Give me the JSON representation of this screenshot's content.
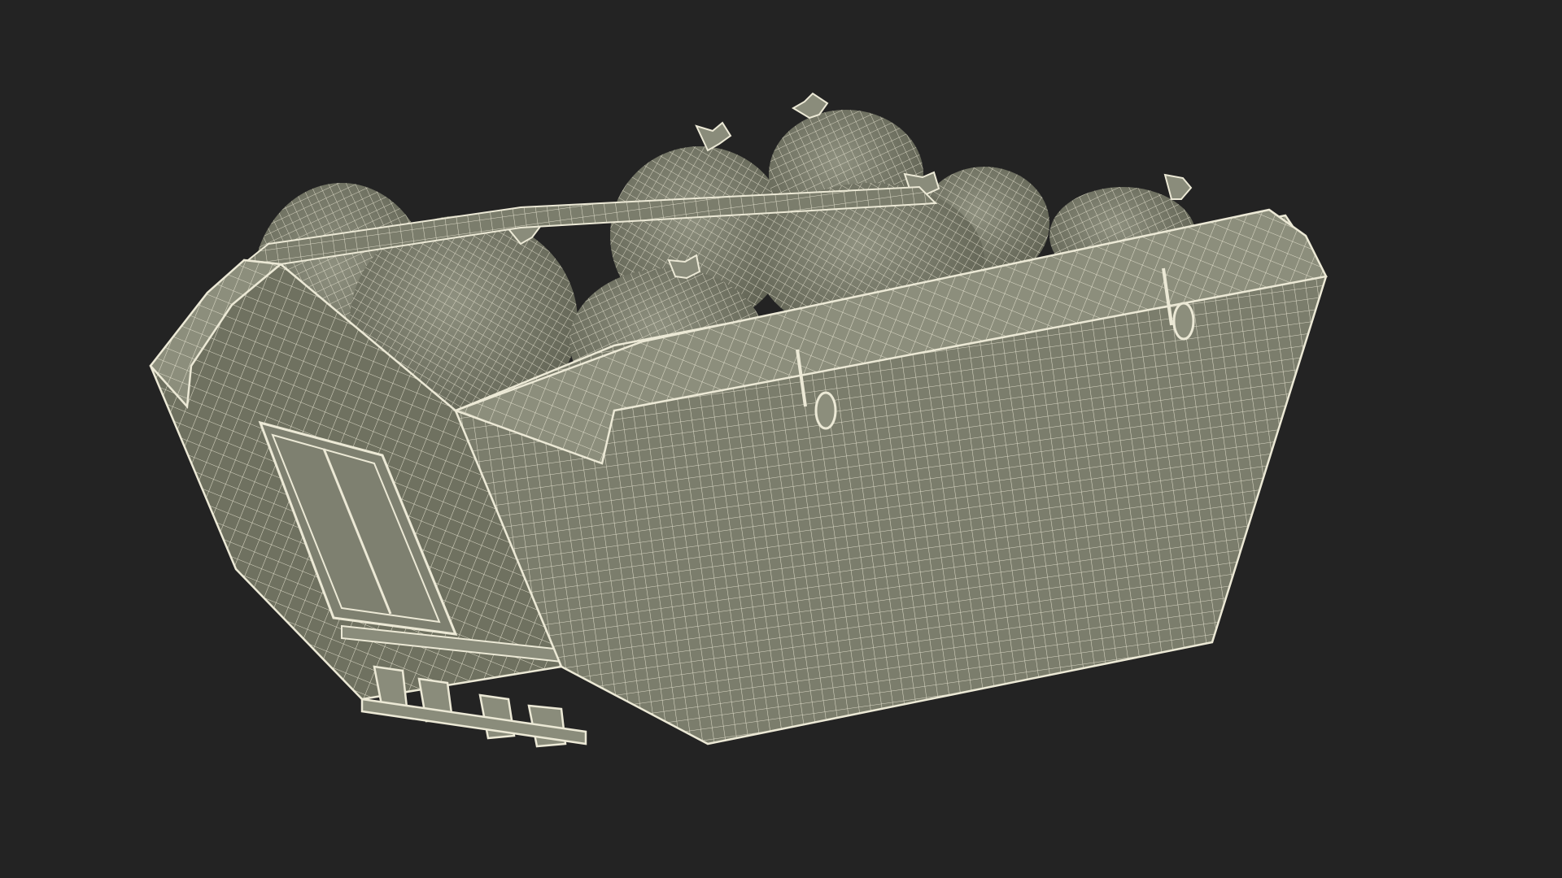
{
  "scene": {
    "subject": "wireframe-skip-bin-with-garbage-bags",
    "colors": {
      "background": "#232323",
      "surface": "#7b7d6c",
      "surface_dark": "#676958",
      "surface_light": "#8c8e7c",
      "wire": "#ece9d6",
      "bag": "#8a8c7b",
      "bag_shade": "#6c6e5e"
    }
  }
}
